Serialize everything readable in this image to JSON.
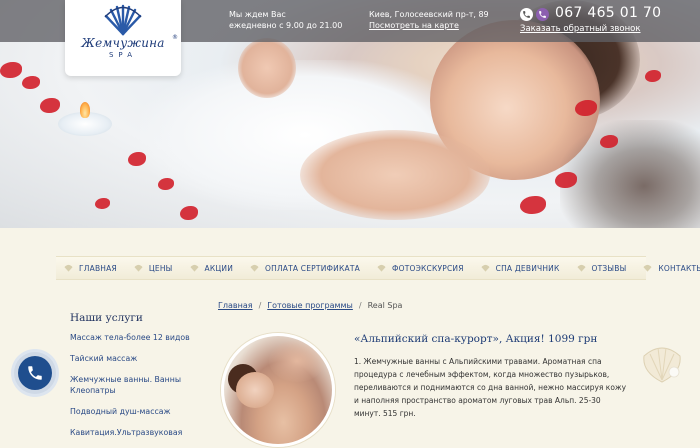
{
  "header": {
    "logo": {
      "brand": "Жемчужина",
      "registered": "®",
      "sub": "SPA"
    },
    "hours": {
      "line1": "Мы ждем Вас",
      "line2": "ежедневно с 9.00 до 21.00"
    },
    "address": {
      "text": "Киев, Голосеевский пр-т, 89",
      "map_link": "Посмотреть на карте"
    },
    "phone": {
      "number": "067 465 01 70",
      "callback": "Заказать обратный звонок",
      "icons": [
        "phone-icon",
        "viber-icon"
      ]
    }
  },
  "nav": {
    "items": [
      {
        "label": "ГЛАВНАЯ"
      },
      {
        "label": "ЦЕНЫ"
      },
      {
        "label": "АКЦИИ"
      },
      {
        "label": "ОПЛАТА СЕРТИФИКАТА"
      },
      {
        "label": "ФОТОЭКСКУРСИЯ"
      },
      {
        "label": "СПА ДЕВИЧНИК"
      },
      {
        "label": "ОТЗЫВЫ"
      },
      {
        "label": "КОНТАКТЫ"
      }
    ]
  },
  "sidebar": {
    "title": "Наши услуги",
    "items": [
      {
        "label": "Массаж тела-более 12 видов"
      },
      {
        "label": "Тайский массаж"
      },
      {
        "label": "Жемчужные ванны. Ванны Клеопатры"
      },
      {
        "label": "Подводный душ-массаж"
      },
      {
        "label": "Кавитация.Ультразвуковая"
      }
    ]
  },
  "breadcrumb": {
    "home": "Главная",
    "section": "Готовые программы",
    "current": "Real Spa",
    "separator": "/"
  },
  "article": {
    "title": "«Альпийский спа-курорт», Акция! 1099 грн",
    "body": "1. Жемчужные ванны  с Альпийскими травами. Ароматная спа процедура с лечебным эффектом, когда множество пузырьков, переливаются и поднимаются со дна ванной, нежно массируя кожу и наполняя пространство ароматом луговых трав Альп. 25-30 минут. 515 грн."
  },
  "colors": {
    "brand_blue": "#1f3c7a",
    "link_blue": "#2a4a86",
    "background": "#f7f4e8",
    "viber_purple": "#8c5fb0"
  }
}
